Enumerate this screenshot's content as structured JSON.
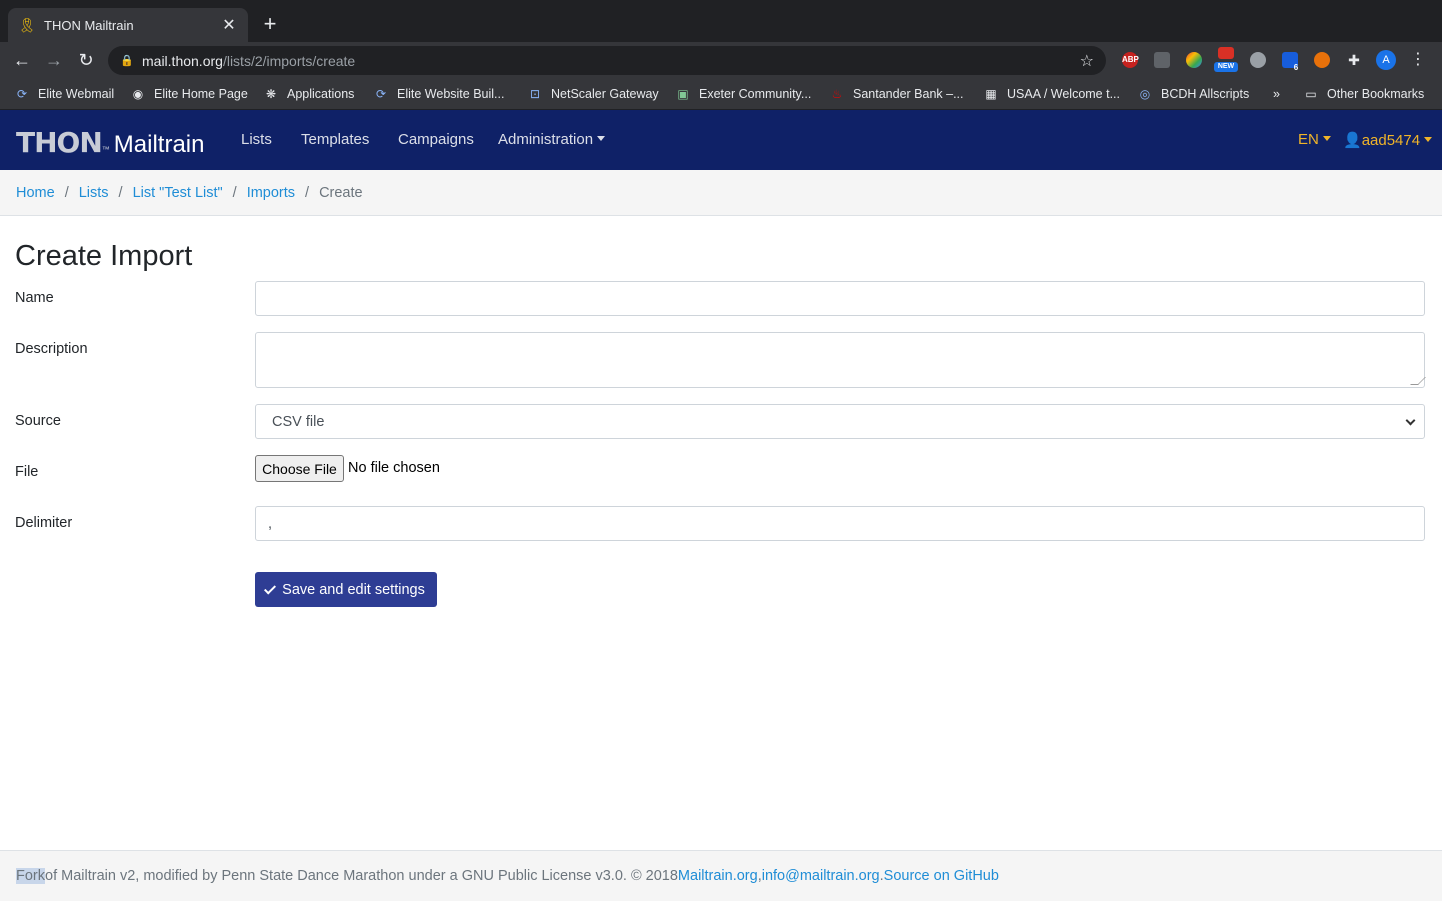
{
  "browser": {
    "tab_title": "THON Mailtrain",
    "url_host": "mail.thon.org",
    "url_path": "/lists/2/imports/create",
    "profile_initial": "A",
    "ext_badge_new": "NEW",
    "ext_badge_count": "6",
    "ext_abp": "ABP"
  },
  "bookmarks": [
    {
      "label": "Elite Webmail"
    },
    {
      "label": "Elite Home Page"
    },
    {
      "label": "Applications"
    },
    {
      "label": "Elite Website Buil..."
    },
    {
      "label": "NetScaler Gateway"
    },
    {
      "label": "Exeter Community..."
    },
    {
      "label": "Santander Bank –..."
    },
    {
      "label": "USAA / Welcome t..."
    },
    {
      "label": "BCDH Allscripts"
    }
  ],
  "bookmarks_overflow": "»",
  "bookmarks_other": "Other Bookmarks",
  "app": {
    "brand_thon": "THON",
    "brand_tm": "™",
    "brand_mailtrain": "Mailtrain",
    "nav": [
      "Lists",
      "Templates",
      "Campaigns",
      "Administration"
    ],
    "lang": "EN",
    "user": "aad5474"
  },
  "breadcrumb": [
    "Home",
    "Lists",
    "List \"Test List\"",
    "Imports",
    "Create"
  ],
  "form": {
    "title": "Create Import",
    "name_label": "Name",
    "name_value": "",
    "description_label": "Description",
    "description_value": "",
    "source_label": "Source",
    "source_value": "CSV file",
    "file_label": "File",
    "file_button": "Choose File",
    "file_status": "No file chosen",
    "delimiter_label": "Delimiter",
    "delimiter_value": ",",
    "save_button": "Save and edit settings"
  },
  "footer": {
    "fork": "Fork",
    "text": " of Mailtrain v2, modified by Penn State Dance Marathon under a GNU Public License v3.0. © 2018 ",
    "link1": "Mailtrain.org",
    "sep1": ", ",
    "link2": "info@mailtrain.org",
    "sep2": ". ",
    "link3": "Source on GitHub"
  }
}
